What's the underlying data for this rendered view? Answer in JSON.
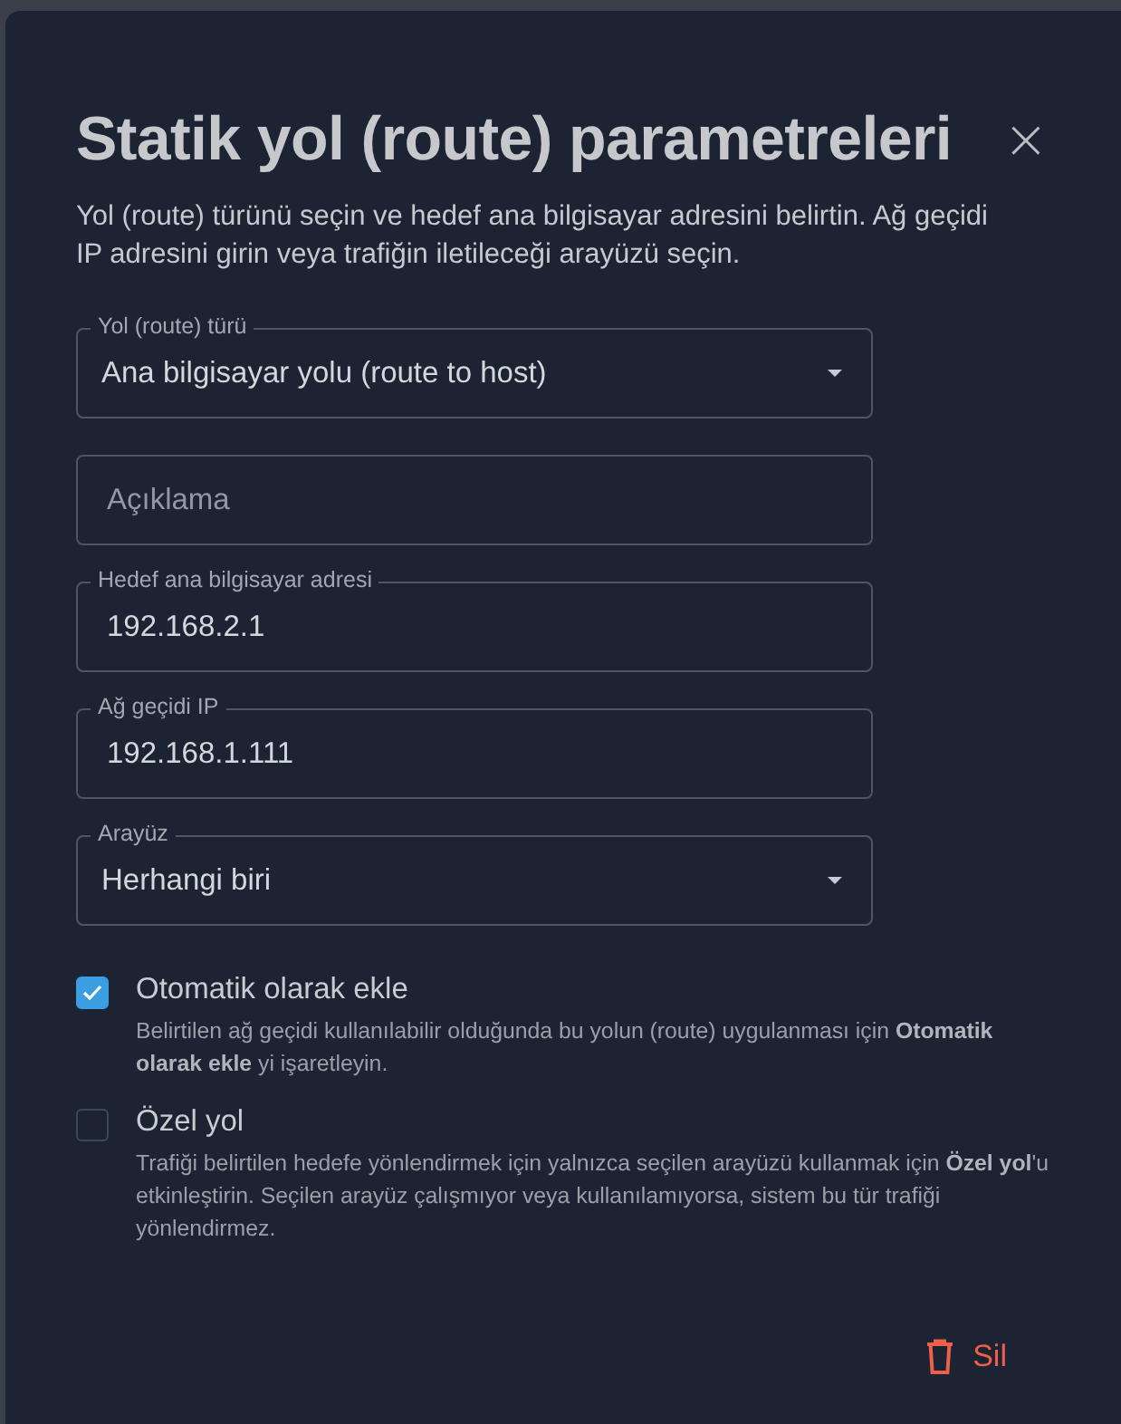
{
  "dialog": {
    "title": "Statik yol (route) parametreleri",
    "close": "×",
    "description": "Yol (route) türünü seçin ve hedef ana bilgisayar adresini belirtin. Ağ geçidi IP adresini girin veya trafiğin iletileceği arayüzü seçin.",
    "fields": [
      {
        "kind": "select",
        "label": "Yol (route) türü",
        "value": "Ana bilgisayar yolu (route to host)"
      },
      {
        "kind": "text",
        "placeholder": "Açıklama"
      },
      {
        "kind": "text",
        "label": "Hedef ana bilgisayar adresi",
        "value": "192.168.2.1"
      },
      {
        "kind": "text",
        "label": "Ağ geçidi IP",
        "value": "192.168.1.111"
      },
      {
        "kind": "select",
        "label": "Arayüz",
        "value": "Herhangi biri"
      }
    ],
    "options": [
      {
        "label": "Otomatik olarak ekle",
        "checked": true,
        "help": "Belirtilen ağ geçidi kullanılabilir olduğunda bu yolun (route) uygulanması için **Otomatik olarak ekle** yi işaretleyin."
      },
      {
        "label": "Özel yol",
        "checked": false,
        "help": "Trafiği belirtilen hedefe yönlendirmek için yalnızca seçilen arayüzü kullanmak için **Özel yol**'u etkinleştirin. Seçilen arayüz çalışmıyor veya kullanılamıyorsa, sistem bu tür trafiği yönlendirmez."
      }
    ],
    "delete_button": "Sil"
  }
}
